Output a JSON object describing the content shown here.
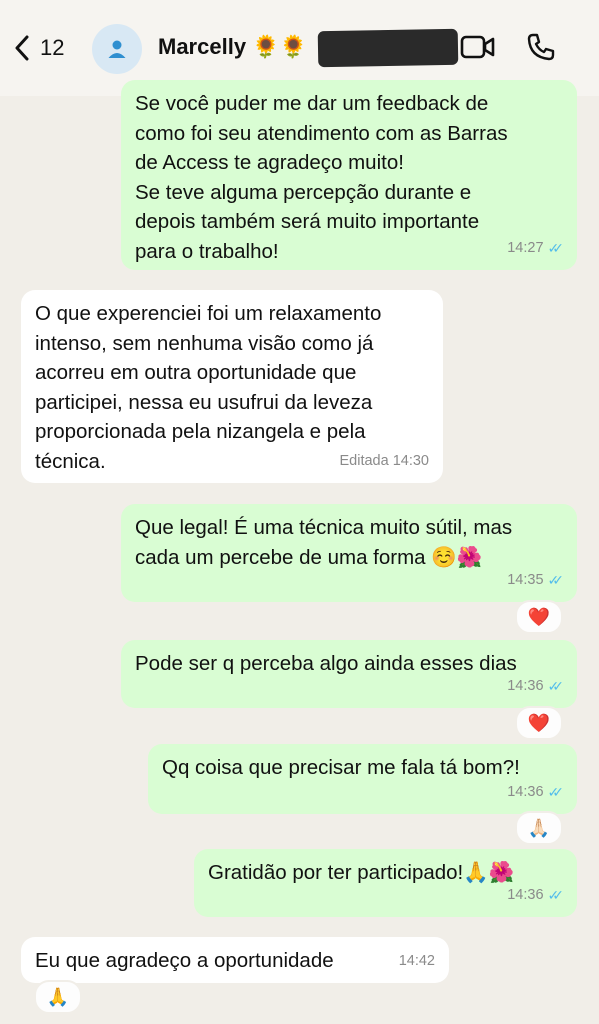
{
  "header": {
    "back_count": "12",
    "contact_name": "Marcelly 🌻🌻"
  },
  "messages": [
    {
      "text": "Se você puder me dar um feedback de\ncomo foi seu atendimento com as Barras\nde Access te agradeço muito!\nSe teve alguma percepção durante e\ndepois também será muito importante\npara o trabalho!",
      "time": "14:27",
      "ticks": "✓✓"
    },
    {
      "text": "O que experenciei foi um relaxamento\nintenso, sem nenhuma visão como já\nacorreu em outra oportunidade que\nparticipei, nessa eu usufrui da leveza\nproporcionada pela nizangela e pela\ntécnica.",
      "time": "Editada 14:30"
    },
    {
      "text": "Que legal! É uma técnica muito sútil, mas\ncada um percebe de uma forma ☺️🌺",
      "time": "14:35",
      "ticks": "✓✓",
      "reaction": "❤️"
    },
    {
      "text": "Pode ser q perceba algo ainda esses dias",
      "time": "14:36",
      "ticks": "✓✓",
      "reaction": "❤️"
    },
    {
      "text": "Qq coisa que precisar me fala tá bom?!",
      "time": "14:36",
      "ticks": "✓✓",
      "reaction": "🙏🏻"
    },
    {
      "text": "Gratidão por ter participado!🙏🌺",
      "time": "14:36",
      "ticks": "✓✓"
    },
    {
      "text": "Eu que agradeço a oportunidade",
      "time": "14:42",
      "reaction": "🙏"
    }
  ],
  "icons": {
    "back": "chevron-left-icon",
    "avatar": "person-icon",
    "video": "video-camera-icon",
    "phone": "phone-icon"
  },
  "colors": {
    "outgoing_bubble": "#d9fdd3",
    "incoming_bubble": "#ffffff",
    "background": "#f1eee8",
    "read_ticks": "#53bdeb"
  }
}
